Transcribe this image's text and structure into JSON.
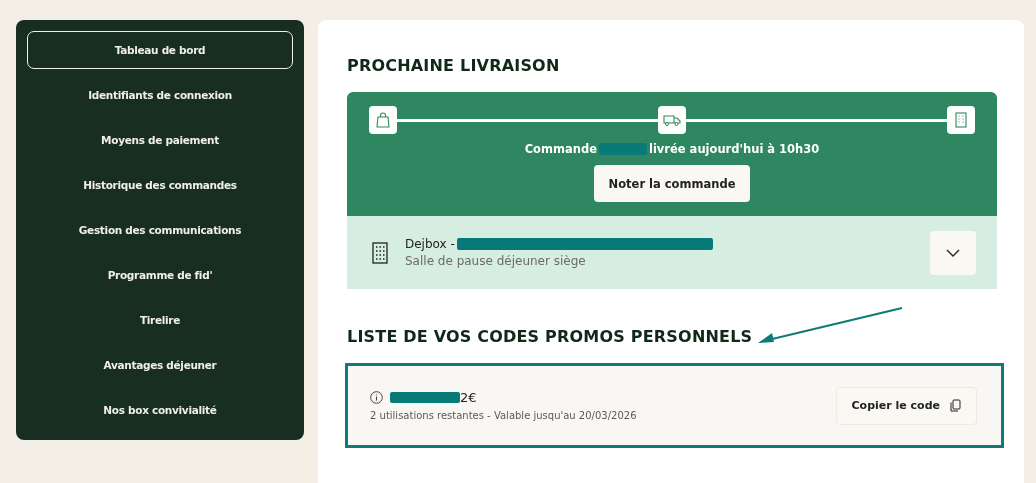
{
  "sidebar": {
    "items": [
      {
        "label": "Tableau de bord",
        "selected": true
      },
      {
        "label": "Identifiants de connexion",
        "selected": false
      },
      {
        "label": "Moyens de paiement",
        "selected": false
      },
      {
        "label": "Historique des commandes",
        "selected": false
      },
      {
        "label": "Gestion des communications",
        "selected": false
      },
      {
        "label": "Programme de fid'",
        "selected": false
      },
      {
        "label": "Tirelire",
        "selected": false
      },
      {
        "label": "Avantages déjeuner",
        "selected": false
      },
      {
        "label": "Nos box convivialité",
        "selected": false
      }
    ]
  },
  "next_delivery": {
    "title": "PROCHAINE LIVRAISON",
    "status_prefix": "Commande",
    "status_suffix": "livrée aujourd'hui à 10h30",
    "rate_button": "Noter la commande",
    "location_name": "Dejbox -",
    "location_detail": "Salle de pause déjeuner siège"
  },
  "promo_codes": {
    "title": "LISTE DE VOS CODES PROMOS PERSONNELS",
    "codes": [
      {
        "amount": "2€",
        "details": "2 utilisations restantes - Valable jusqu'au 20/03/2026",
        "copy_button": "Copier le code"
      }
    ]
  }
}
